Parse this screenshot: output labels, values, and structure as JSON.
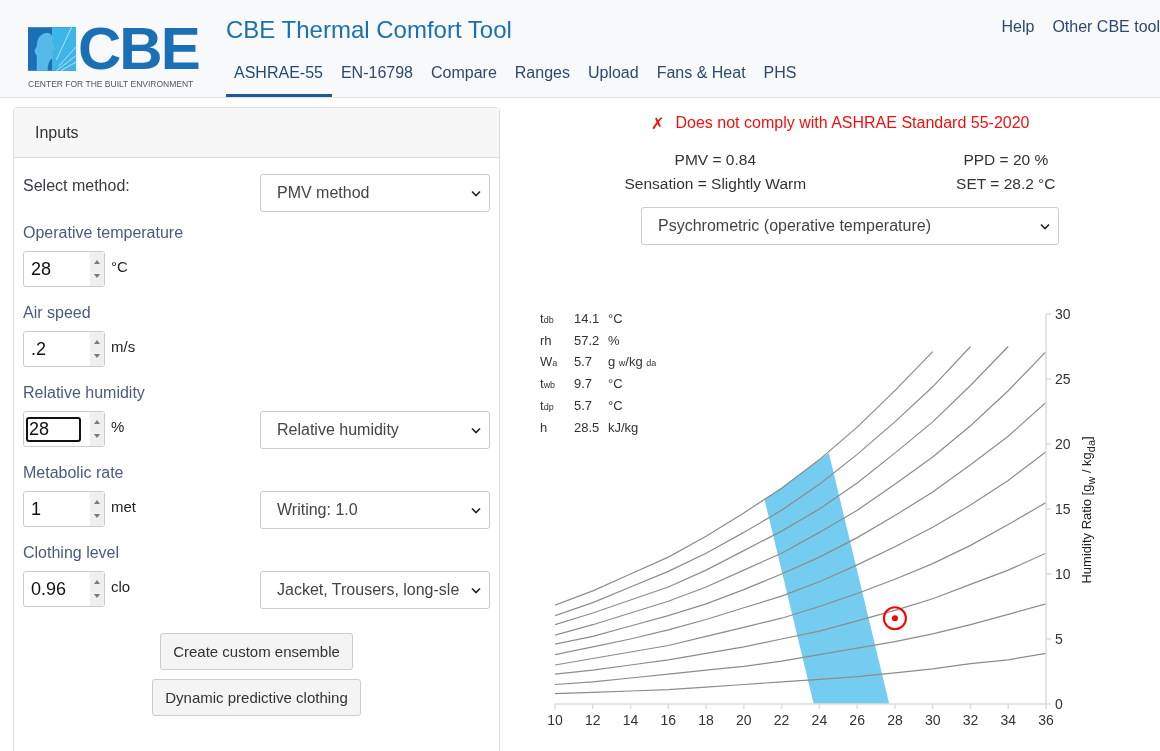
{
  "header": {
    "logo": {
      "text": "CBE",
      "subtitle": "CENTER FOR THE BUILT ENVIRONMENT"
    },
    "title": "CBE Thermal Comfort Tool",
    "tabs": [
      {
        "label": "ASHRAE-55",
        "selected": true
      },
      {
        "label": "EN-16798",
        "selected": false
      },
      {
        "label": "Compare",
        "selected": false
      },
      {
        "label": "Ranges",
        "selected": false
      },
      {
        "label": "Upload",
        "selected": false
      },
      {
        "label": "Fans & Heat",
        "selected": false
      },
      {
        "label": "PHS",
        "selected": false
      }
    ],
    "links": [
      "Help",
      "Other CBE tool"
    ]
  },
  "inputs_panel": {
    "title": "Inputs",
    "rows": [
      {
        "kind": "select",
        "label": "Select method:",
        "select": "PMV method"
      },
      {
        "kind": "number",
        "label": "Operative temperature",
        "value": "28",
        "unit": "°C",
        "focused": false
      },
      {
        "kind": "number",
        "label": "Air speed",
        "value": ".2",
        "unit": "m/s",
        "focused": false
      },
      {
        "kind": "number",
        "label": "Relative humidity",
        "value": "28",
        "unit": "%",
        "focused": true,
        "select": "Relative humidity"
      },
      {
        "kind": "number",
        "label": "Metabolic rate",
        "value": "1",
        "unit": "met",
        "focused": false,
        "select": "Writing: 1.0"
      },
      {
        "kind": "number",
        "label": "Clothing level",
        "value": "0.96",
        "unit": "clo",
        "focused": false,
        "select": "Jacket, Trousers, long-sle"
      }
    ],
    "buttons": [
      "Create custom ensemble",
      "Dynamic predictive clothing"
    ]
  },
  "results": {
    "compliant": false,
    "mark": "✗",
    "message": "Does not comply with ASHRAE Standard 55-2020",
    "values": [
      [
        "PMV = 0.84",
        "Sensation = Slightly Warm"
      ],
      [
        "PPD = 20 %",
        "SET = 28.2 °C"
      ]
    ],
    "chart_select": "Psychrometric (operative temperature)",
    "readout": [
      {
        "label": "t$_{db}$",
        "value": "14.1",
        "unit": "°C"
      },
      {
        "label": "rh",
        "value": "57.2",
        "unit": "%"
      },
      {
        "label": "W$_{a}$",
        "value": "5.7",
        "unit": "g $_{w}$/kg $_{da}$"
      },
      {
        "label": "t$_{wb}$",
        "value": "9.7",
        "unit": "°C"
      },
      {
        "label": "t$_{dp}$",
        "value": "5.7",
        "unit": "°C"
      },
      {
        "label": "h",
        "value": "28.5",
        "unit": "kJ/kg"
      }
    ],
    "chart_data": {
      "type": "line",
      "ylabel": "Humidity Ratio [g$_{w}$ / kg$_{da}$]",
      "x": [
        10,
        12,
        14,
        16,
        18,
        20,
        22,
        24,
        26,
        28,
        30,
        32,
        34,
        36
      ],
      "xlim": [
        10,
        36
      ],
      "ylim": [
        0,
        30
      ],
      "xticks": [
        10,
        12,
        14,
        16,
        18,
        20,
        22,
        24,
        26,
        28,
        30,
        32,
        34,
        36
      ],
      "yticks": [
        0,
        5,
        10,
        15,
        20,
        25,
        30
      ],
      "series": [
        {
          "color": "#8c8c8c",
          "values": [
            0.8,
            0.9,
            1.0,
            1.1,
            1.3,
            1.5,
            1.7,
            1.9,
            2.1,
            2.4,
            2.7,
            3.1,
            3.4,
            3.9
          ]
        },
        {
          "color": "#8c8c8c",
          "values": [
            1.5,
            1.7,
            2.0,
            2.3,
            2.6,
            2.9,
            3.3,
            3.8,
            4.3,
            4.8,
            5.4,
            6.1,
            6.9,
            7.7
          ]
        },
        {
          "color": "#8c8c8c",
          "values": [
            2.3,
            2.6,
            3.0,
            3.4,
            3.9,
            4.4,
            5.0,
            5.6,
            6.4,
            7.2,
            8.1,
            9.2,
            10.3,
            11.6
          ]
        },
        {
          "color": "#8c8c8c",
          "values": [
            3.0,
            3.5,
            4.0,
            4.5,
            5.2,
            5.9,
            6.6,
            7.5,
            8.5,
            9.6,
            10.8,
            12.2,
            13.8,
            15.5
          ]
        },
        {
          "color": "#8c8c8c",
          "values": [
            3.8,
            4.4,
            5.0,
            5.7,
            6.5,
            7.4,
            8.3,
            9.4,
            10.7,
            12.1,
            13.6,
            15.3,
            17.2,
            19.4
          ]
        },
        {
          "color": "#8c8c8c",
          "values": [
            4.6,
            5.2,
            6.0,
            6.8,
            7.7,
            8.8,
            10.0,
            11.3,
            12.8,
            14.5,
            16.3,
            18.4,
            20.6,
            23.2
          ]
        },
        {
          "color": "#8c8c8c",
          "values": [
            5.3,
            6.1,
            7.0,
            7.9,
            9.0,
            10.3,
            11.6,
            13.2,
            14.9,
            16.9,
            19.0,
            21.4,
            24.1,
            27.1
          ]
        },
        {
          "color": "#8c8c8c",
          "values": [
            6.1,
            7.0,
            8.0,
            9.0,
            10.3,
            11.8,
            13.3,
            15.0,
            17.0,
            19.3,
            21.7,
            24.5,
            27.5,
            null
          ]
        },
        {
          "color": "#8c8c8c",
          "values": [
            6.8,
            7.8,
            9.0,
            10.2,
            11.6,
            13.2,
            14.9,
            16.9,
            19.2,
            21.7,
            24.4,
            27.5,
            null,
            null
          ]
        },
        {
          "color": "#8c8c8c",
          "values": [
            7.6,
            8.7,
            10.0,
            11.3,
            12.9,
            14.7,
            16.6,
            18.8,
            21.3,
            24.1,
            27.1,
            null,
            null,
            null
          ]
        }
      ]
    }
  }
}
